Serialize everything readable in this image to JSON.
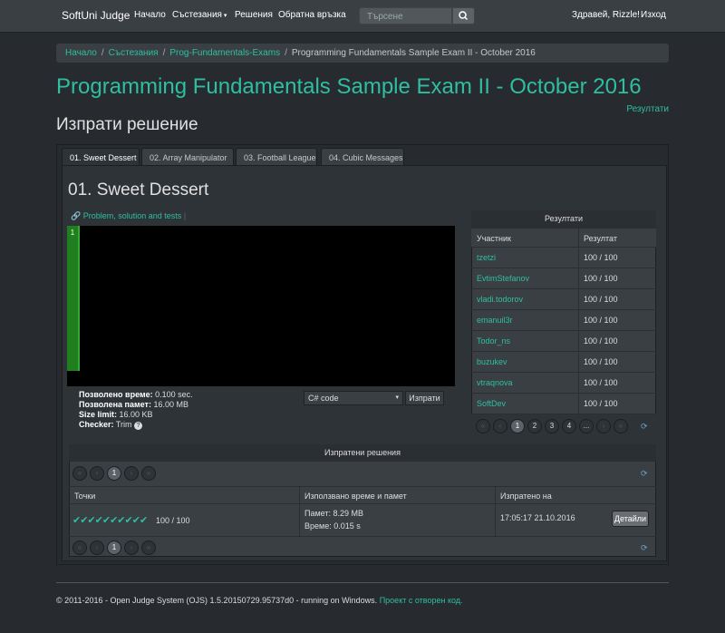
{
  "nav": {
    "brand": "SoftUni Judge",
    "home": "Начало",
    "contests": "Състезания",
    "submissions": "Решения",
    "feedback": "Обратна връзка",
    "search_placeholder": "Търсене",
    "greeting": "Здравей, Rizzle!",
    "logout": "Изход"
  },
  "breadcrumb": [
    "Начало",
    "Състезания",
    "Prog-Fundamentals-Exams",
    "Programming Fundamentals Sample Exam II - October 2016"
  ],
  "page_title": "Programming Fundamentals Sample Exam II - October 2016",
  "results_link": "Резултати",
  "sub_title": "Изпрати решение",
  "tabs": [
    "01. Sweet Dessert",
    "02. Array Manipulator",
    "03. Football League",
    "04. Cubic Messages"
  ],
  "problem": {
    "title": "01. Sweet Dessert",
    "link": "Problem, solution and tests",
    "line_number": "1",
    "limits": [
      {
        "label": "Позволено време:",
        "value": "0.100 sec."
      },
      {
        "label": "Позволена памет:",
        "value": "16.00 MB"
      },
      {
        "label": "Size limit:",
        "value": "16.00 KB"
      },
      {
        "label": "Checker:",
        "value": "Trim"
      }
    ],
    "language": "C# code",
    "submit": "Изпрати"
  },
  "results": {
    "title": "Резултати",
    "col_participant": "Участник",
    "col_result": "Резултат",
    "rows": [
      {
        "user": "tzetzi",
        "score": "100 / 100"
      },
      {
        "user": "EvtimStefanov",
        "score": "100 / 100"
      },
      {
        "user": "vladi.todorov",
        "score": "100 / 100"
      },
      {
        "user": "emanuil3r",
        "score": "100 / 100"
      },
      {
        "user": "Todor_ns",
        "score": "100 / 100"
      },
      {
        "user": "buzukev",
        "score": "100 / 100"
      },
      {
        "user": "vtraqnova",
        "score": "100 / 100"
      },
      {
        "user": "SoftDev",
        "score": "100 / 100"
      }
    ],
    "pages": [
      "«",
      "‹",
      "1",
      "2",
      "3",
      "4",
      "...",
      "›",
      "»"
    ]
  },
  "submissions": {
    "title": "Изпратени решения",
    "col_points": "Точки",
    "col_time_memory": "Използвано време и памет",
    "col_sent": "Изпратено на",
    "checks": "✔✔✔✔✔✔✔✔✔✔",
    "score": "100 / 100",
    "memory": "Памет: 8.29 MB",
    "time": "Време: 0.015 s",
    "sent_at": "17:05:17 21.10.2016",
    "details": "Детайли",
    "pages": [
      "«",
      "‹",
      "1",
      "›",
      "»"
    ]
  },
  "footer": {
    "text": "© 2011-2016 - Open Judge System (OJS) 1.5.20150729.95737d0 - running on Windows.",
    "link": "Проект с отворен код."
  }
}
